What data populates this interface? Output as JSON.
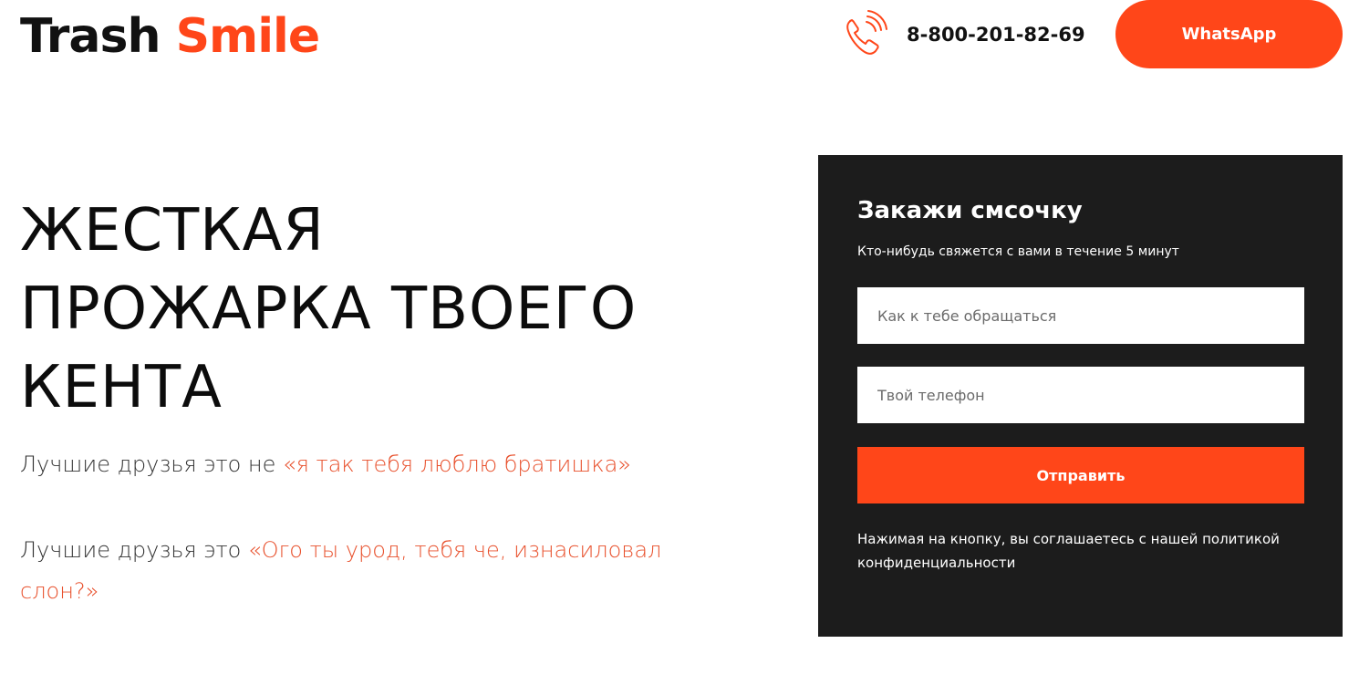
{
  "header": {
    "logo_part1": "Trash",
    "logo_part2": "Smile",
    "phone": "8-800-201-82-69",
    "whatsapp_label": "WhatsApp",
    "phone_icon": "phone-ringing-icon"
  },
  "hero": {
    "title_lines": [
      "ЖЕСТКАЯ",
      "ПРОЖАРКА ТВОЕГО",
      "КЕНТА"
    ],
    "para1_prefix": "Лучшие друзья это не ",
    "para1_quote": "«я так тебя люблю братишка»",
    "para2_prefix": "Лучшие друзья это ",
    "para2_quote": "«Ого ты урод, тебя че, изнасиловал слон?»"
  },
  "form": {
    "title": "Закажи смсочку",
    "subtitle": "Кто-нибудь свяжется с вами в течение 5 минут",
    "name_placeholder": "Как к тебе обращаться",
    "phone_placeholder": "Твой телефон",
    "submit_label": "Отправить",
    "note": "Нажимая на кнопку, вы соглашаетесь с нашей политикой конфиденциальности"
  },
  "colors": {
    "accent": "#ff4619",
    "quote": "#e8502c",
    "panel": "#1c1c1c"
  }
}
